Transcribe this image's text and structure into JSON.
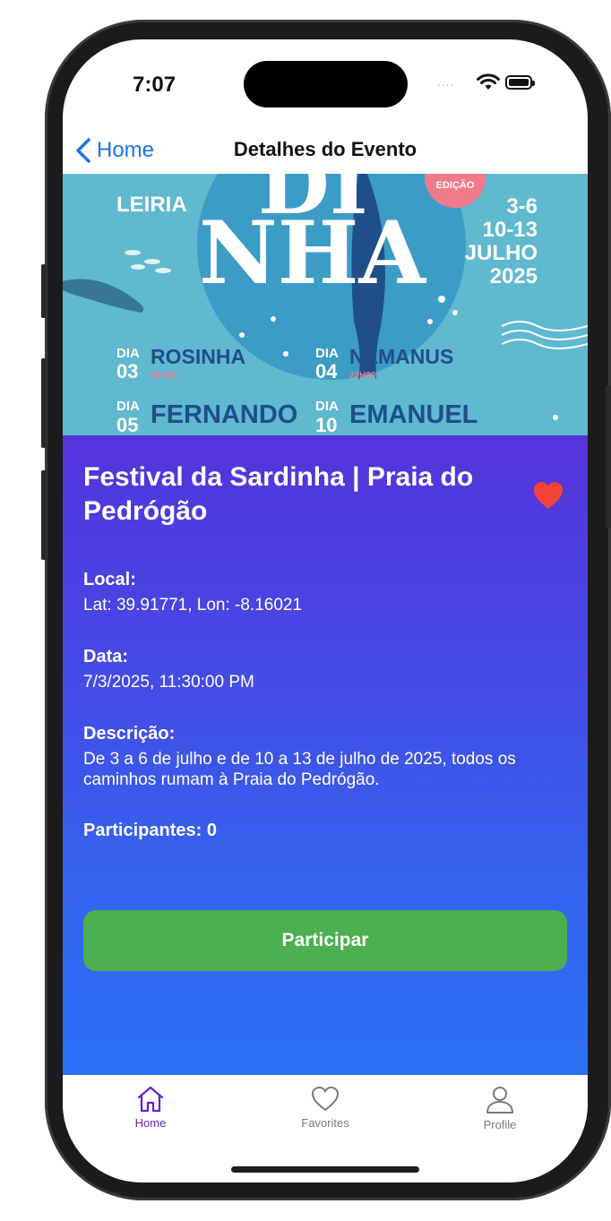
{
  "status_bar": {
    "time": "7:07",
    "signal_dots": "....",
    "wifi_icon": "wifi-icon",
    "battery_icon": "battery-icon"
  },
  "nav": {
    "back_label": "Home",
    "title": "Detalhes do Evento"
  },
  "poster": {
    "place": "LEIRIA",
    "edition": "EDIÇÃO",
    "dates": [
      "3-6",
      "10-13",
      "JULHO",
      "2025"
    ],
    "headline_fragment_1": "DI",
    "headline_fragment_2": "NHA",
    "lineup": [
      {
        "day_word": "DIA",
        "day": "03",
        "artist": "ROSINHA",
        "time": "22H30"
      },
      {
        "day_word": "DIA",
        "day": "04",
        "artist": "NEMANUS",
        "time": "22H30"
      },
      {
        "day_word": "DIA",
        "day": "05",
        "artist": "FERNANDO",
        "time": ""
      },
      {
        "day_word": "DIA",
        "day": "10",
        "artist": "EMANUEL",
        "time": ""
      }
    ]
  },
  "event": {
    "title": "Festival da Sardinha | Praia do Pedrógão",
    "favorite": true,
    "location_label": "Local:",
    "location_value": "Lat: 39.91771, Lon: -8.16021",
    "date_label": "Data:",
    "date_value": "7/3/2025, 11:30:00 PM",
    "description_label": "Descrição:",
    "description_value": "De 3 a 6 de julho e de 10 a 13 de julho de 2025, todos os caminhos rumam à Praia do Pedrógão.",
    "participants_label": "Participantes: 0",
    "participate_button": "Participar"
  },
  "tabs": [
    {
      "label": "Home",
      "icon": "home-icon",
      "active": true
    },
    {
      "label": "Favorites",
      "icon": "heart-icon",
      "active": false
    },
    {
      "label": "Profile",
      "icon": "person-icon",
      "active": false
    }
  ],
  "colors": {
    "accent_blue": "#1b74ea",
    "gradient_top": "#5433da",
    "gradient_bottom": "#2b70f5",
    "participate_green": "#4caf50",
    "favorite_red": "#f44336",
    "tab_active": "#6a1fc9",
    "tab_inactive": "#7a7a7a",
    "poster_bg": "#5fb9cf",
    "poster_pink": "#f07a8a",
    "poster_navy": "#1f4e8a"
  }
}
